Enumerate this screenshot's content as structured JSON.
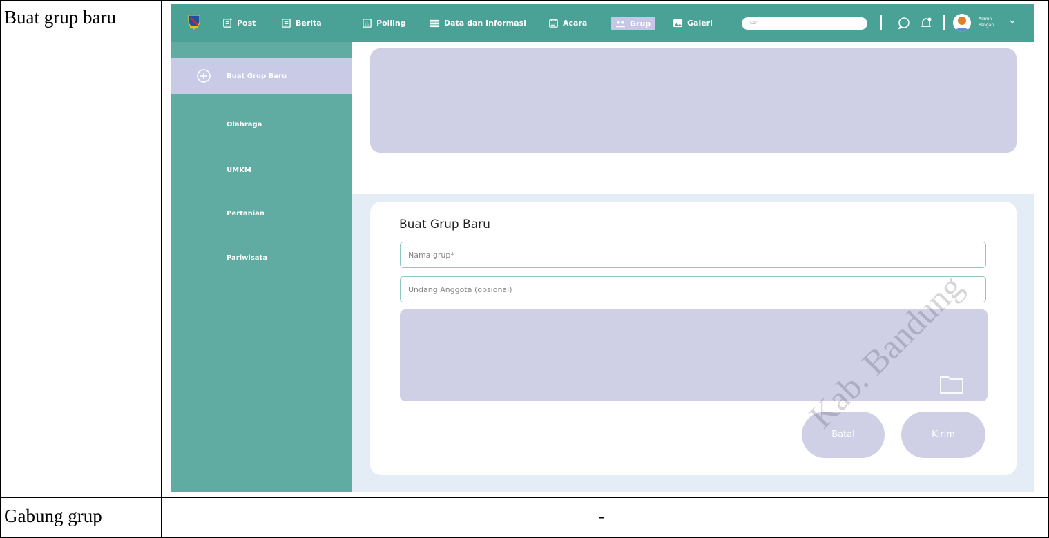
{
  "table": {
    "rows": [
      {
        "label": "Buat grup baru"
      },
      {
        "label": "Gabung grup",
        "value": "-"
      }
    ]
  },
  "nav": {
    "items": [
      {
        "label": "Post",
        "icon": "post-icon"
      },
      {
        "label": "Berita",
        "icon": "news-icon"
      },
      {
        "label": "Polling",
        "icon": "polling-icon"
      },
      {
        "label": "Data dan Informasi",
        "icon": "data-icon"
      },
      {
        "label": "Acara",
        "icon": "calendar-icon"
      },
      {
        "label": "Grup",
        "icon": "group-icon",
        "active": true
      },
      {
        "label": "Galeri",
        "icon": "gallery-icon"
      }
    ],
    "search_placeholder": "Cari",
    "user_name": "Admin",
    "user_role": "Pangan"
  },
  "sidebar": {
    "items": [
      {
        "label": "Buat Grup Baru",
        "active": true
      },
      {
        "label": "Olahraga"
      },
      {
        "label": "UMKM"
      },
      {
        "label": "Pertanian"
      },
      {
        "label": "Pariwisata"
      }
    ]
  },
  "form": {
    "title": "Buat Grup Baru",
    "group_name_placeholder": "Nama grup*",
    "invite_placeholder": "Undang Anggota (opsional)",
    "cancel_label": "Batal",
    "submit_label": "Kirim"
  },
  "watermark": "Kab. Bandung",
  "colors": {
    "primary": "#4aa196",
    "sidebar": "#60aba2",
    "accent": "#cfd0e6",
    "background": "#e4ecf6"
  }
}
